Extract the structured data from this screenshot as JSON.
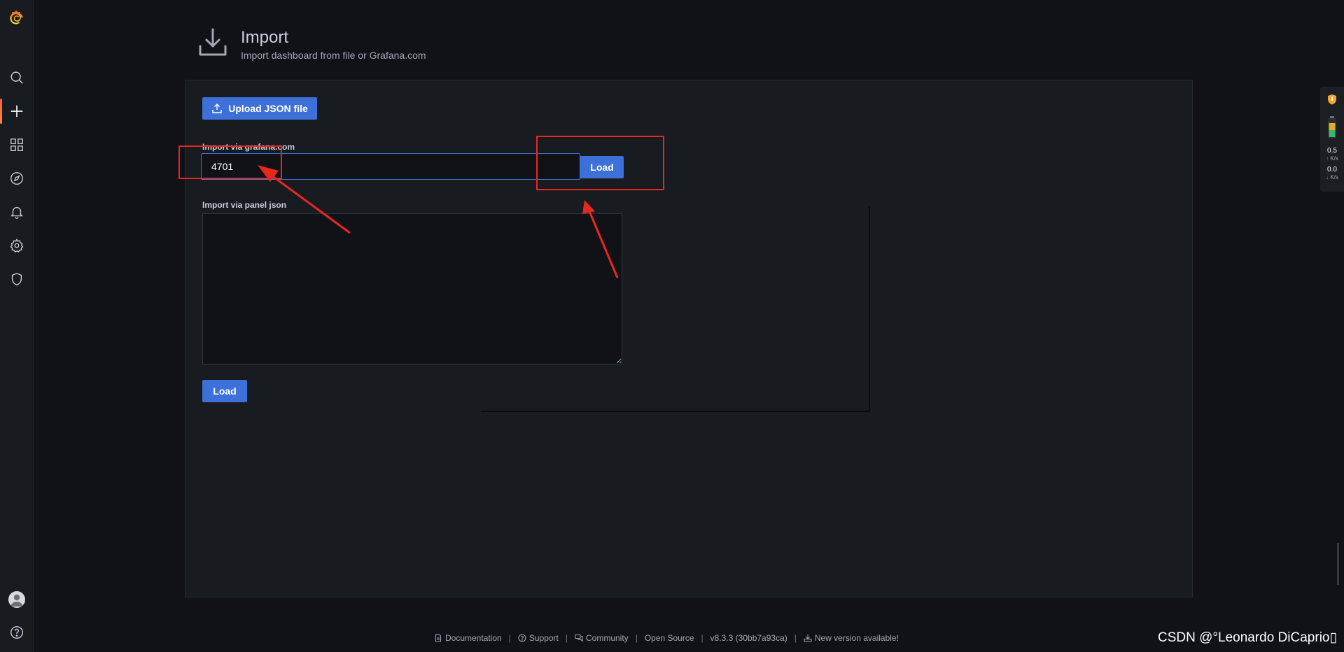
{
  "header": {
    "title": "Import",
    "subtitle": "Import dashboard from file or Grafana.com"
  },
  "upload": {
    "label": "Upload JSON file"
  },
  "grafana_com": {
    "label": "Import via grafana.com",
    "value": "4701",
    "load_label": "Load"
  },
  "panel_json": {
    "label": "Import via panel json",
    "value": "",
    "load_label": "Load"
  },
  "sidebar": {
    "items": [
      {
        "name": "grafana-logo",
        "icon": "grafana-logo"
      },
      {
        "name": "search",
        "icon": "search-icon"
      },
      {
        "name": "create",
        "icon": "plus-icon",
        "active": true
      },
      {
        "name": "dashboards",
        "icon": "apps-icon"
      },
      {
        "name": "explore",
        "icon": "compass-icon"
      },
      {
        "name": "alerting",
        "icon": "bell-icon"
      },
      {
        "name": "configuration",
        "icon": "cog-icon"
      },
      {
        "name": "server-admin",
        "icon": "shield-icon"
      },
      {
        "name": "profile",
        "icon": "user-avatar"
      },
      {
        "name": "help",
        "icon": "question-circle-icon"
      }
    ]
  },
  "network_widget": {
    "up_value": "0.5",
    "up_unit": "K/s",
    "down_value": "0.0",
    "down_unit": "K/s"
  },
  "footer": {
    "documentation": "Documentation",
    "support": "Support",
    "community": "Community",
    "open_source": "Open Source",
    "version": "v8.3.3 (30bb7a93ca)",
    "new_version": "New version available!"
  },
  "watermark": "CSDN @°Leonardo DiCaprio▯",
  "colors": {
    "accent": "#3d71d9",
    "annotation": "#e8281c",
    "background": "#111217",
    "panel": "#181b1f"
  }
}
